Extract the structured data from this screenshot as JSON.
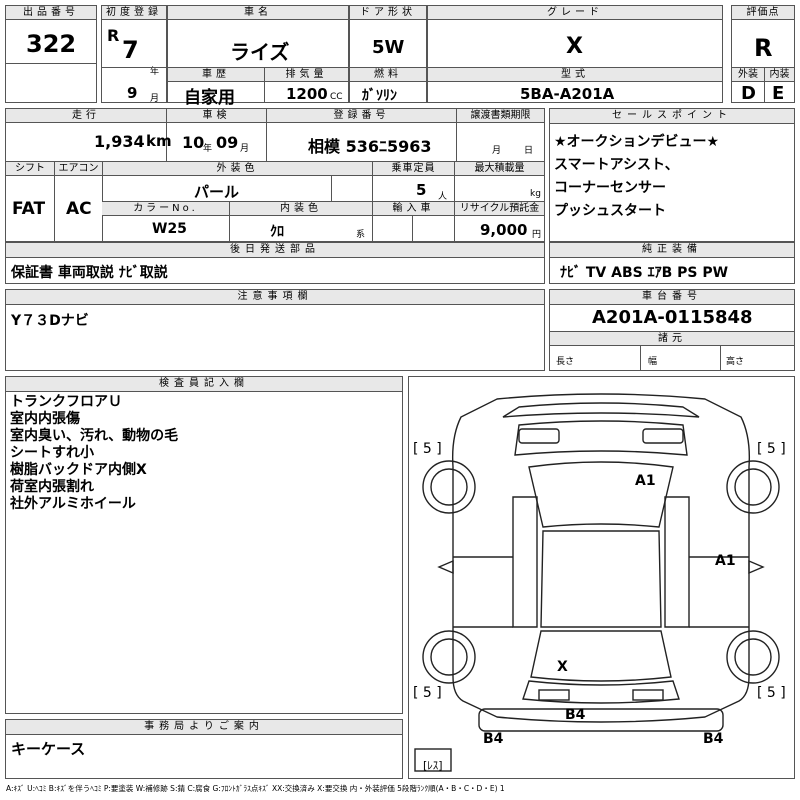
{
  "header": {
    "lot_no_label": "出品番号",
    "lot_no": "322",
    "first_reg_label": "初度登録",
    "era": "R",
    "reg_year": "7",
    "year_unit": "年",
    "reg_month": "9",
    "month_unit": "月",
    "car_name_label": "車名",
    "car_name": "ライズ",
    "history_label": "車歴",
    "history": "自家用",
    "displacement_label": "排気量",
    "displacement": "1200",
    "cc_unit": "CC",
    "door_label": "ドア形状",
    "door": "5W",
    "fuel_label": "燃料",
    "fuel": "ｶﾞｿﾘﾝ",
    "grade_label": "グレード",
    "grade": "X",
    "model_label": "型式",
    "model": "5BA-A201A",
    "score_label": "評価点",
    "score": "R",
    "ext_label": "外装",
    "int_label": "内装",
    "ext_score": "D",
    "int_score": "E"
  },
  "details": {
    "mileage_label": "走行",
    "mileage": "1,934",
    "km_unit": "km",
    "inspection_label": "車検",
    "inspection_year": "10",
    "inspection_month": "09",
    "year_unit": "年",
    "month_unit": "月",
    "plate_label": "登録番号",
    "plate": "相模 536ﾆ5963",
    "transfer_label": "譲渡書類期限",
    "transfer_month": "月",
    "transfer_day": "日",
    "shift_label": "シフト",
    "shift": "FAT",
    "ac_label": "エアコン",
    "ac": "AC",
    "ext_color_label": "外装色",
    "ext_color": "パール",
    "capacity_label": "乗車定員",
    "capacity": "5",
    "capacity_unit": "人",
    "max_load_label": "最大積載量",
    "max_load_unit": "kg",
    "color_no_label": "カラーNo.",
    "color_no": "W25",
    "int_color_label": "内装色",
    "int_color": "ｸﾛ",
    "int_color_unit": "系",
    "import_label": "輸入車",
    "recycle_label": "リサイクル預託金",
    "recycle": "9,000",
    "recycle_unit": "円"
  },
  "sales_points": {
    "label": "セールスポイント",
    "lines": [
      "★オークションデビュー★",
      "スマートアシスト、",
      "コーナーセンサー",
      "プッシュスタート"
    ]
  },
  "later_parts": {
    "label": "後日発送部品",
    "text": "保証書 車両取説 ﾅﾋﾞ取説"
  },
  "genuine": {
    "label": "純正装備",
    "text": "ﾅﾋﾞ TV ABS ｴｱB PS PW"
  },
  "notes": {
    "label": "注意事項欄",
    "text": "Y７３Dナビ"
  },
  "chassis": {
    "label": "車台番号",
    "value": "A201A-0115848",
    "dims_label": "諸元",
    "length_label": "長さ",
    "width_label": "幅",
    "height_label": "高さ"
  },
  "inspector": {
    "label": "検査員記入欄",
    "lines": [
      "トランクフロアＵ",
      "室内内張傷",
      "室内臭い、汚れ、動物の毛",
      "シートすれ小",
      "樹脂バックドア内側X",
      "荷室内張割れ",
      "社外アルミホイール"
    ]
  },
  "office": {
    "label": "事務局よりご案内",
    "text": "キーケース"
  },
  "diagram": {
    "tire_marks": [
      "[ 5 ]",
      "[ 5 ]",
      "[ 5 ]",
      "[ 5 ]"
    ],
    "marks": [
      "A1",
      "A1",
      "X",
      "B4",
      "B4",
      "B4"
    ],
    "less_label": "[ﾚｽ]"
  },
  "legend": "A:ｷｽﾞ U:ﾍｺﾐ B:ｷｽﾞを伴うﾍｺﾐ P:要塗装 W:補修跡 S:錆 C:腐食 G:ﾌﾛﾝﾄｶﾞﾗｽ点ｷｽﾞ XX:交換済み X:要交換 内・外装評価 5段階ﾗﾝｸ順(A・B・C・D・E) 1"
}
